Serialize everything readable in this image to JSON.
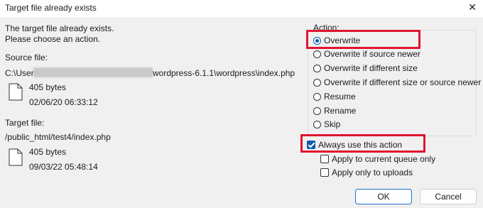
{
  "window": {
    "title": "Target file already exists",
    "close_glyph": "✕"
  },
  "message": {
    "line1": "The target file already exists.",
    "line2": "Please choose an action."
  },
  "source": {
    "label": "Source file:",
    "path_prefix": "C:\\Users",
    "path_suffix": "wordpress-6.1.1\\wordpress\\index.php",
    "size": "405 bytes",
    "date": "02/06/20 06:33:12",
    "icon": "file-icon"
  },
  "target": {
    "label": "Target file:",
    "path": "/public_html/test4/index.php",
    "size": "405 bytes",
    "date": "09/03/22 05:48:14",
    "icon": "file-icon"
  },
  "action": {
    "title": "Action:",
    "options": [
      {
        "label": "Overwrite",
        "checked": true
      },
      {
        "label": "Overwrite if source newer",
        "checked": false
      },
      {
        "label": "Overwrite if different size",
        "checked": false
      },
      {
        "label": "Overwrite if different size or source newer",
        "checked": false
      },
      {
        "label": "Resume",
        "checked": false
      },
      {
        "label": "Rename",
        "checked": false
      },
      {
        "label": "Skip",
        "checked": false
      }
    ]
  },
  "options": {
    "always": {
      "label": "Always use this action",
      "checked": true
    },
    "queue_only": {
      "label": "Apply to current queue only",
      "checked": false
    },
    "uploads_only": {
      "label": "Apply only to uploads",
      "checked": false
    }
  },
  "buttons": {
    "ok": "OK",
    "cancel": "Cancel"
  },
  "colors": {
    "highlight": "#e0142f",
    "accent": "#0b5cad"
  }
}
